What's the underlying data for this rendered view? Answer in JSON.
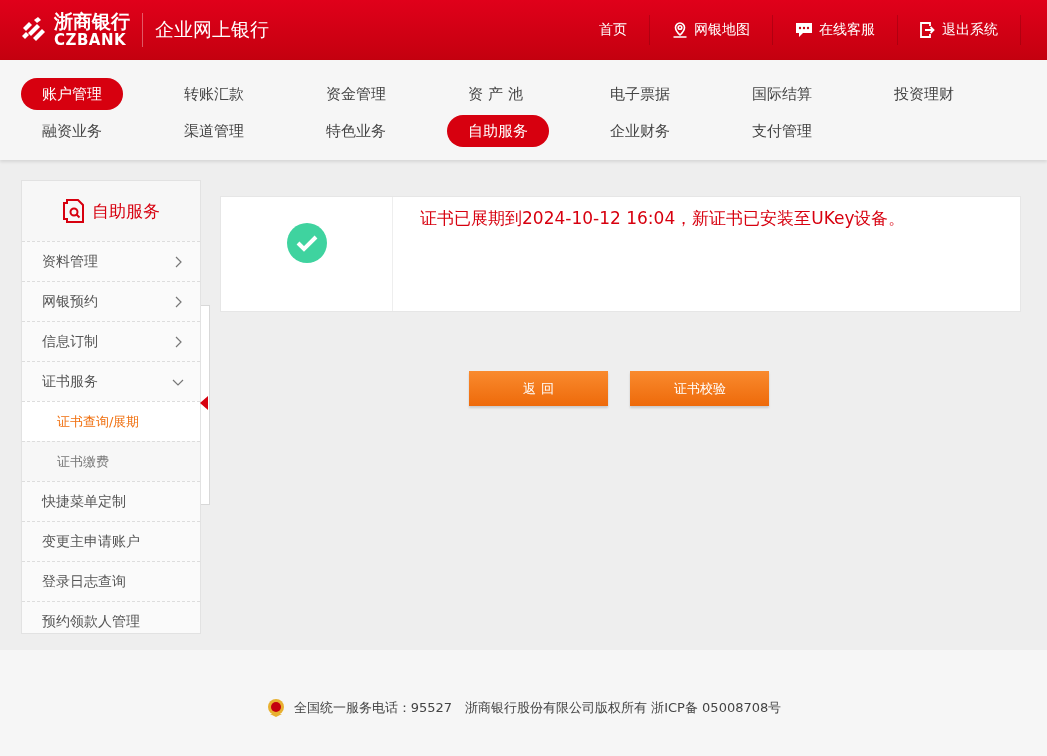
{
  "header": {
    "logo_cn": "浙商银行",
    "logo_en": "CZBANK",
    "title": "企业网上银行",
    "links": [
      {
        "label": "首页",
        "kind": "plain"
      },
      {
        "label": "网银地图",
        "kind": "map"
      },
      {
        "label": "在线客服",
        "kind": "chat"
      },
      {
        "label": "退出系统",
        "kind": "logout"
      }
    ]
  },
  "nav": {
    "tabs": [
      {
        "label": "账户管理",
        "selected": true
      },
      {
        "label": "转账汇款",
        "selected": false
      },
      {
        "label": "资金管理",
        "selected": false
      },
      {
        "label": "资 产 池",
        "selected": false
      },
      {
        "label": "电子票据",
        "selected": false
      },
      {
        "label": "国际结算",
        "selected": false
      },
      {
        "label": "投资理财",
        "selected": false
      },
      {
        "label": "融资业务",
        "selected": false
      },
      {
        "label": "渠道管理",
        "selected": false
      },
      {
        "label": "特色业务",
        "selected": false
      },
      {
        "label": "自助服务",
        "selected": true
      },
      {
        "label": "企业财务",
        "selected": false
      },
      {
        "label": "支付管理",
        "selected": false
      }
    ]
  },
  "sidebar": {
    "title": "自助服务",
    "items": [
      {
        "label": "资料管理",
        "kind": "group",
        "expanded": false
      },
      {
        "label": "网银预约",
        "kind": "group",
        "expanded": false
      },
      {
        "label": "信息订制",
        "kind": "group",
        "expanded": false
      },
      {
        "label": "证书服务",
        "kind": "group",
        "expanded": true,
        "children": [
          {
            "label": "证书查询/展期",
            "selected": true
          },
          {
            "label": "证书缴费",
            "selected": false
          }
        ]
      },
      {
        "label": "快捷菜单定制",
        "kind": "link"
      },
      {
        "label": "变更主申请账户",
        "kind": "link"
      },
      {
        "label": "登录日志查询",
        "kind": "link"
      },
      {
        "label": "预约领款人管理",
        "kind": "link"
      }
    ]
  },
  "result": {
    "kind": "success",
    "message": "证书已展期到2024-10-12 16:04，新证书已安装至UKey设备。"
  },
  "buttons": [
    "返 回",
    "证书校验"
  ],
  "footer": {
    "text": "全国统一服务电话：95527　浙商银行股份有限公司版权所有 浙ICP备 05008708号"
  }
}
